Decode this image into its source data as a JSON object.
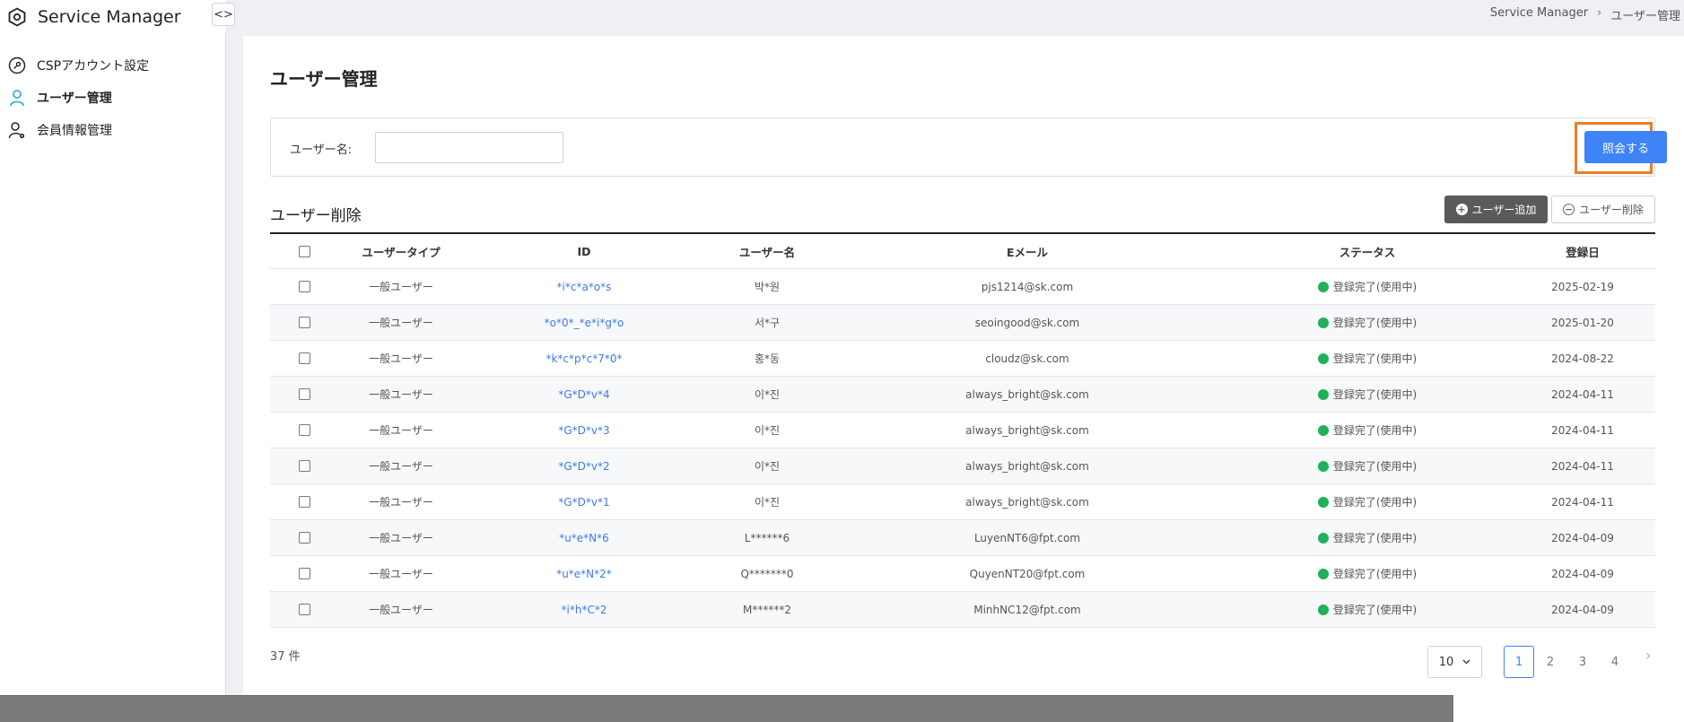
{
  "app": {
    "title": "Service Manager",
    "collapse_glyph": "<>"
  },
  "breadcrumb": {
    "root": "Service Manager",
    "separator": "›",
    "current": "ユーザー管理"
  },
  "sidebar": {
    "items": [
      {
        "label": "CSPアカウント設定",
        "icon": "key-circle-icon"
      },
      {
        "label": "ユーザー管理",
        "icon": "user-icon",
        "active": true
      },
      {
        "label": "会員情報管理",
        "icon": "user-gear-icon"
      }
    ]
  },
  "page": {
    "title": "ユーザー管理"
  },
  "search": {
    "label": "ユーザー名:",
    "value": "",
    "query_button": "照会する"
  },
  "section": {
    "title": "ユーザー削除",
    "add_button": "ユーザー追加",
    "delete_button": "ユーザー削除"
  },
  "table": {
    "headers": [
      "ユーザータイプ",
      "ID",
      "ユーザー名",
      "Eメール",
      "ステータス",
      "登録日"
    ],
    "rows": [
      {
        "type": "一般ユーザー",
        "id": "*i*c*a*o*s",
        "name": "박*원",
        "email": "pjs1214@sk.com",
        "status": "登録完了(使用中)",
        "date": "2025-02-19"
      },
      {
        "type": "一般ユーザー",
        "id": "*o*0*_*e*i*g*o",
        "name": "서*구",
        "email": "seoingood@sk.com",
        "status": "登録完了(使用中)",
        "date": "2025-01-20"
      },
      {
        "type": "一般ユーザー",
        "id": "*k*c*p*c*7*0*",
        "name": "홍*동",
        "email": "cloudz@sk.com",
        "status": "登録完了(使用中)",
        "date": "2024-08-22"
      },
      {
        "type": "一般ユーザー",
        "id": "*G*D*v*4",
        "name": "이*진",
        "email": "always_bright@sk.com",
        "status": "登録完了(使用中)",
        "date": "2024-04-11"
      },
      {
        "type": "一般ユーザー",
        "id": "*G*D*v*3",
        "name": "이*진",
        "email": "always_bright@sk.com",
        "status": "登録完了(使用中)",
        "date": "2024-04-11"
      },
      {
        "type": "一般ユーザー",
        "id": "*G*D*v*2",
        "name": "이*진",
        "email": "always_bright@sk.com",
        "status": "登録完了(使用中)",
        "date": "2024-04-11"
      },
      {
        "type": "一般ユーザー",
        "id": "*G*D*v*1",
        "name": "이*진",
        "email": "always_bright@sk.com",
        "status": "登録完了(使用中)",
        "date": "2024-04-11"
      },
      {
        "type": "一般ユーザー",
        "id": "*u*e*N*6",
        "name": "L******6",
        "email": "LuyenNT6@fpt.com",
        "status": "登録完了(使用中)",
        "date": "2024-04-09"
      },
      {
        "type": "一般ユーザー",
        "id": "*u*e*N*2*",
        "name": "Q*******0",
        "email": "QuyenNT20@fpt.com",
        "status": "登録完了(使用中)",
        "date": "2024-04-09"
      },
      {
        "type": "一般ユーザー",
        "id": "*i*h*C*2",
        "name": "M******2",
        "email": "MinhNC12@fpt.com",
        "status": "登録完了(使用中)",
        "date": "2024-04-09"
      }
    ]
  },
  "footer": {
    "total": "37 件",
    "page_size": "10",
    "pages": [
      "1",
      "2",
      "3",
      "4"
    ],
    "current_page": "1",
    "next_glyph": "›"
  },
  "colors": {
    "primary": "#3f83f8",
    "highlight": "#f07b25",
    "status_ok": "#20b15a",
    "add_button": "#5a5a5a"
  }
}
